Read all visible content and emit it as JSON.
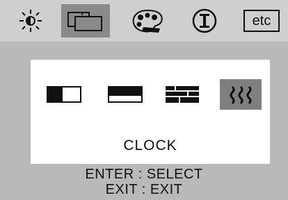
{
  "tabs": [
    {
      "icon": "brightness-icon",
      "selected": false
    },
    {
      "icon": "geometry-icon",
      "selected": true
    },
    {
      "icon": "color-icon",
      "selected": false
    },
    {
      "icon": "information-icon",
      "selected": false
    },
    {
      "label": "etc",
      "selected": false
    }
  ],
  "submenu": {
    "items": [
      {
        "icon": "h-size-icon",
        "selected": false
      },
      {
        "icon": "v-size-icon",
        "selected": false
      },
      {
        "icon": "phase-icon",
        "selected": false
      },
      {
        "icon": "clock-icon",
        "selected": true
      }
    ],
    "label": "CLOCK"
  },
  "hints": {
    "enter": "ENTER : SELECT",
    "exit": "EXIT : EXIT"
  }
}
